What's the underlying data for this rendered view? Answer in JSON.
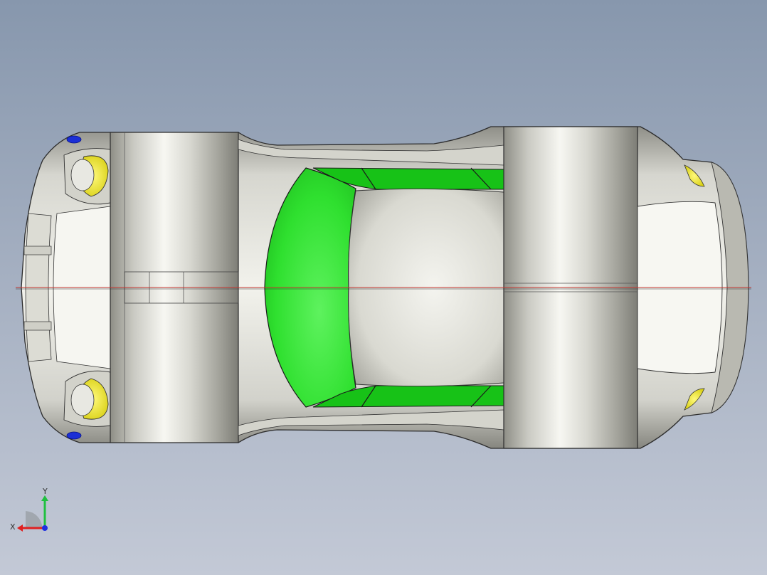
{
  "viewport": {
    "background_top": "#8797ad",
    "background_bottom": "#c3c9d6"
  },
  "model": {
    "body_color": "#e9e9e3",
    "glass_color": "#2fe02f",
    "light_color": "#f2ec3a",
    "marker_color": "#1b2fd6",
    "centerline_color": "#c0302a"
  },
  "triad": {
    "x_label": "X",
    "y_label": "Y",
    "x_color": "#e02020",
    "y_color": "#20c040",
    "z_color": "#2030e0"
  }
}
